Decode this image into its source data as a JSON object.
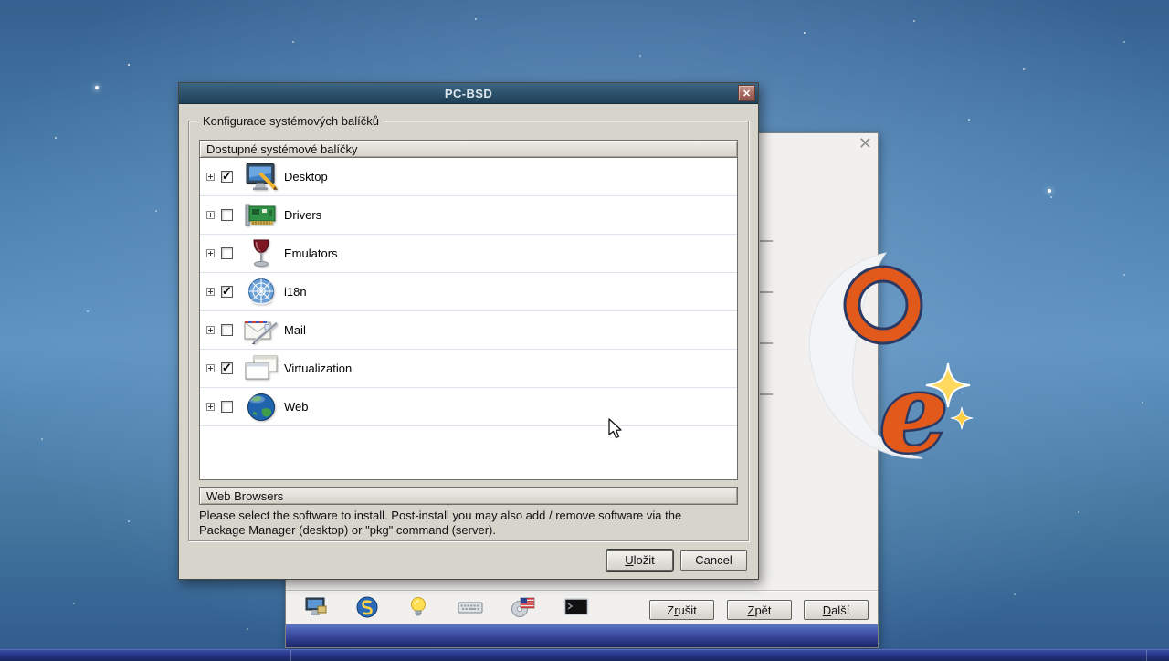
{
  "window": {
    "title": "PC-BSD",
    "close_icon": "close-icon"
  },
  "groupbox": {
    "label": "Konfigurace systémových balíčků"
  },
  "tree": {
    "header": "Dostupné systémové balíčky",
    "items": [
      {
        "label": "Desktop",
        "checked": true,
        "icon": "desktop-icon"
      },
      {
        "label": "Drivers",
        "checked": false,
        "icon": "drivers-icon"
      },
      {
        "label": "Emulators",
        "checked": false,
        "icon": "emulators-icon"
      },
      {
        "label": "i18n",
        "checked": true,
        "icon": "i18n-icon"
      },
      {
        "label": "Mail",
        "checked": false,
        "icon": "mail-icon"
      },
      {
        "label": "Virtualization",
        "checked": true,
        "icon": "virtualization-icon"
      },
      {
        "label": "Web",
        "checked": false,
        "icon": "web-icon"
      }
    ]
  },
  "selection_bar": "Web Browsers",
  "description": {
    "line1": "Please select the software to install. Post-install you may also add / remove software via the",
    "line2": "Package Manager (desktop) or \"pkg\" command (server)."
  },
  "buttons": {
    "save": {
      "label": "Uložit",
      "key": "U"
    },
    "cancel": {
      "label": "Cancel",
      "key": ""
    }
  },
  "wizard": {
    "close_glyph": "✕",
    "toolbar_icons": [
      "system-icon",
      "language-icon",
      "hints-icon",
      "keyboard-icon",
      "locale-icon",
      "terminal-icon"
    ],
    "cancel": {
      "label": "Zrušit",
      "key": "r"
    },
    "back": {
      "label": "Zpět",
      "key": "Z"
    },
    "next": {
      "label": "Další",
      "key": "D"
    }
  },
  "colors": {
    "titlebar": "#2b5069",
    "accent_orange": "#e2591c",
    "navy_outline": "#2c3a63",
    "band_blue": "#35459a"
  }
}
